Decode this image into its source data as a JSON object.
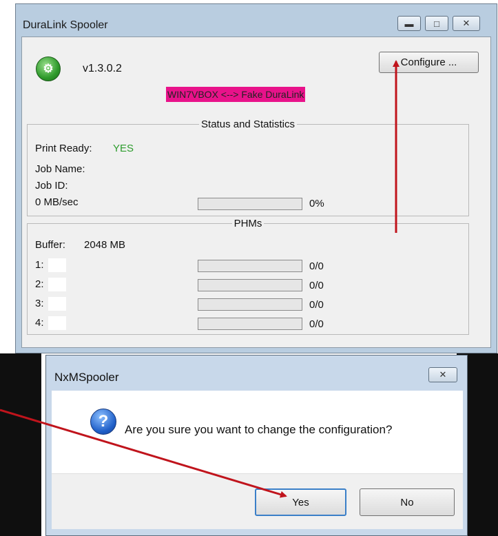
{
  "main_window": {
    "title": "DuraLink Spooler",
    "version": "v1.3.0.2",
    "connection": "WIN7VBOX <--> Fake DuraLink",
    "configure_button": "Configure ...",
    "status_group": {
      "title": "Status and Statistics",
      "print_ready_label": "Print Ready:",
      "print_ready_value": "YES",
      "job_name_label": "Job Name:",
      "job_id_label": "Job ID:",
      "speed": "0 MB/sec",
      "progress_text": "0%",
      "progress_fraction": 0
    },
    "phms_group": {
      "title": "PHMs",
      "buffer_label": "Buffer:",
      "buffer_value": "2048 MB",
      "rows": [
        {
          "label": "1:",
          "value": "0/0"
        },
        {
          "label": "2:",
          "value": "0/0"
        },
        {
          "label": "3:",
          "value": "0/0"
        },
        {
          "label": "4:",
          "value": "0/0"
        }
      ]
    }
  },
  "dialog": {
    "title": "NxMSpooler",
    "message": "Are you sure you want to change the configuration?",
    "yes_button": "Yes",
    "no_button": "No"
  },
  "annotation": {
    "arrow_color": "#c0141c"
  }
}
